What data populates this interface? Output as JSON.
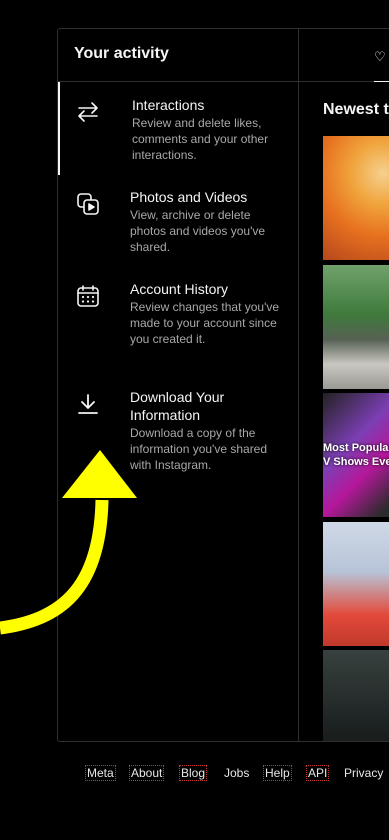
{
  "sidebar": {
    "title": "Your activity",
    "items": [
      {
        "title": "Interactions",
        "description": "Review and delete likes, comments and your other interactions.",
        "icon": "arrows-swap-icon"
      },
      {
        "title": "Photos and Videos",
        "description": "View, archive or delete photos and videos you've shared.",
        "icon": "media-icon"
      },
      {
        "title": "Account History",
        "description": "Review changes that you've made to your account since you created it.",
        "icon": "calendar-icon"
      },
      {
        "title": "Download Your Information",
        "description": "Download a copy of the information you've shared with Instagram.",
        "icon": "download-icon"
      }
    ]
  },
  "content": {
    "tab_icon": "heart-icon",
    "heading": "Newest t",
    "thumbnail_3_text": "Most Popular\nV Shows Ever"
  },
  "footer": {
    "links": [
      "Meta",
      "About",
      "Blog",
      "Jobs",
      "Help",
      "API",
      "Privacy"
    ]
  },
  "colors": {
    "background": "#000000",
    "annotation_arrow": "#ffff00",
    "secondary_text": "#a8a8a8"
  }
}
